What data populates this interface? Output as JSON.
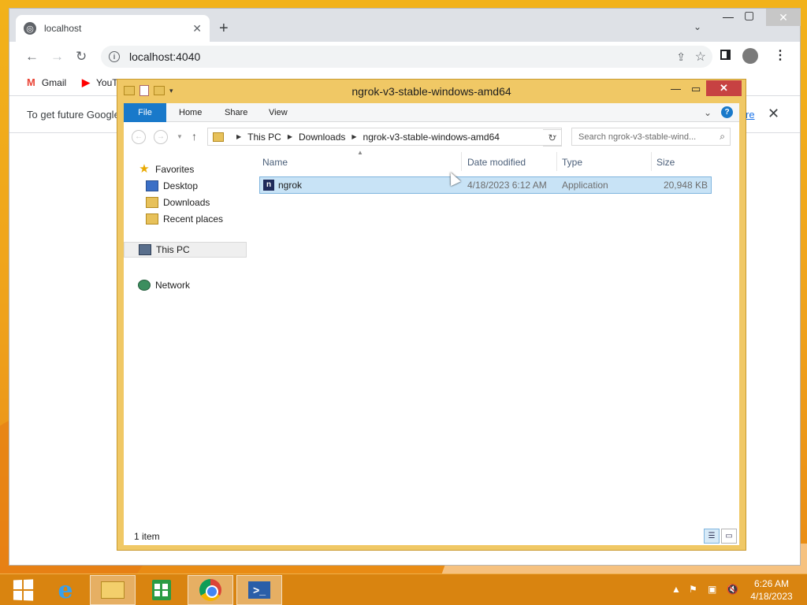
{
  "chrome": {
    "tab_title": "localhost",
    "new_tab": "+",
    "url": "localhost:4040",
    "window_controls": {
      "minimize": "—",
      "maximize": "▢",
      "close": "✕"
    },
    "bookmarks": [
      {
        "label": "Gmail",
        "icon": "gmail-icon",
        "color": "#ea4335"
      },
      {
        "label": "YouT",
        "icon": "youtube-icon",
        "color": "#ff0000"
      }
    ],
    "infobar_text": "To get future Google",
    "infobar_link": "re",
    "infobar_close": "✕"
  },
  "explorer": {
    "title": "ngrok-v3-stable-windows-amd64",
    "close": "✕",
    "ribbon_tabs": [
      "File",
      "Home",
      "Share",
      "View"
    ],
    "help": "?",
    "breadcrumb": [
      "This PC",
      "Downloads",
      "ngrok-v3-stable-windows-amd64"
    ],
    "search_placeholder": "Search ngrok-v3-stable-wind...",
    "nav": {
      "favorites": "Favorites",
      "desktop": "Desktop",
      "downloads": "Downloads",
      "recent": "Recent places",
      "this_pc": "This PC",
      "network": "Network"
    },
    "columns": [
      "Name",
      "Date modified",
      "Type",
      "Size"
    ],
    "files": [
      {
        "name": "ngrok",
        "date": "4/18/2023 6:12 AM",
        "type": "Application",
        "size": "20,948 KB"
      }
    ],
    "status": "1 item"
  },
  "taskbar": {
    "items": [
      "start",
      "internet-explorer",
      "file-explorer",
      "store",
      "chrome",
      "powershell"
    ],
    "active": "file-explorer",
    "time": "6:26 AM",
    "date": "4/18/2023",
    "colors": {
      "taskbar": "#d98410",
      "selection": "#c8e3f6",
      "file_tab": "#1979ca"
    }
  }
}
